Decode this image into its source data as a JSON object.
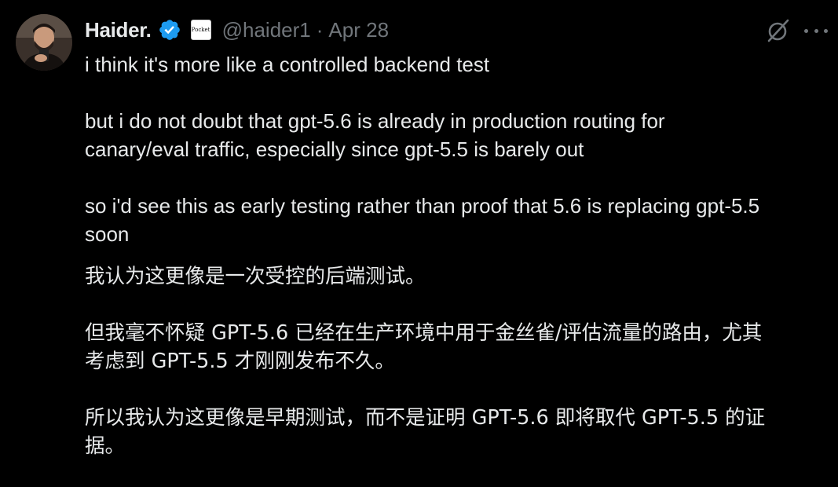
{
  "tweet": {
    "author": {
      "name": "Haider.",
      "handle": "@haider1",
      "affiliation_badge": "Pocket",
      "verified_icon": "verified-badge-icon"
    },
    "separator": "·",
    "date": "Apr 28",
    "icons": {
      "grok": "grok-icon",
      "more": "more-options-icon"
    },
    "text": {
      "en_p1": "i think it's more like a controlled backend test",
      "en_p2_l1": "but i do not doubt that gpt-5.6 is already in production routing for",
      "en_p2_l2": "canary/eval traffic, especially since gpt-5.5 is barely out",
      "en_p3_l1": "so i'd see this as early testing rather than proof that 5.6 is replacing gpt-5.5",
      "en_p3_l2": "soon",
      "cn_p1": "我认为这更像是一次受控的后端测试。",
      "cn_p2_l1": "但我毫不怀疑 GPT-5.6 已经在生产环境中用于金丝雀/评估流量的路由，尤其",
      "cn_p2_l2": "考虑到 GPT-5.5 才刚刚发布不久。",
      "cn_p3_l1": "所以我认为这更像是早期测试，而不是证明 GPT-5.6 即将取代 GPT-5.5 的证",
      "cn_p3_l2": "据。"
    },
    "colors": {
      "background": "#000000",
      "text": "#e7e9ea",
      "secondary": "#71767b",
      "verified": "#1d9bf0"
    }
  }
}
